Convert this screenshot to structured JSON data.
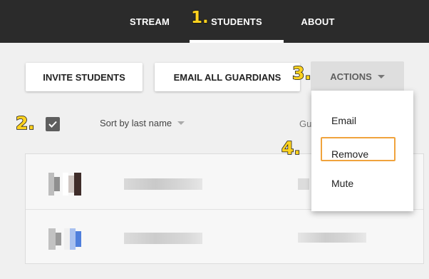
{
  "nav": {
    "tabs": [
      {
        "label": "STREAM"
      },
      {
        "label": "STUDENTS",
        "active": true
      },
      {
        "label": "ABOUT"
      }
    ]
  },
  "steps": {
    "s1": "1.",
    "s2": "2.",
    "s3": "3.",
    "s4": "4."
  },
  "toolbar": {
    "invite_label": "INVITE STUDENTS",
    "email_all_label": "EMAIL ALL GUARDIANS",
    "actions_label": "ACTIONS"
  },
  "list_header": {
    "sort_label": "Sort by last name",
    "guardians_col": "Gu",
    "select_all_checked": true
  },
  "actions_menu": {
    "items": [
      {
        "label": "Email"
      },
      {
        "label": "Remove",
        "highlighted": true
      },
      {
        "label": "Mute"
      }
    ]
  },
  "colors": {
    "topbar": "#2b2b2b",
    "step_badge": "#ffd21f",
    "highlight_border": "#f0a33d"
  }
}
